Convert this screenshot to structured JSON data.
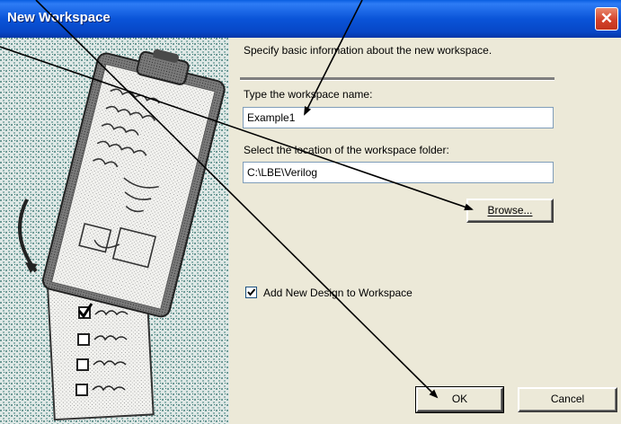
{
  "window": {
    "title": "New Workspace",
    "close_symbol": "✕"
  },
  "header": {
    "instructions": "Specify basic information about the new workspace."
  },
  "workspace_name": {
    "label": "Type the workspace name:",
    "value": "Example1"
  },
  "workspace_location": {
    "label": "Select the location of the workspace folder:",
    "value": "C:\\LBE\\Verilog"
  },
  "browse_button": {
    "label": "Browse..."
  },
  "add_design": {
    "label": "Add New Design to Workspace",
    "checked": true
  },
  "buttons": {
    "ok": "OK",
    "cancel": "Cancel"
  },
  "icons": {
    "illustration": "clipboard-checklist-illustration",
    "close": "close-icon",
    "checkmark": "checkmark-icon"
  }
}
